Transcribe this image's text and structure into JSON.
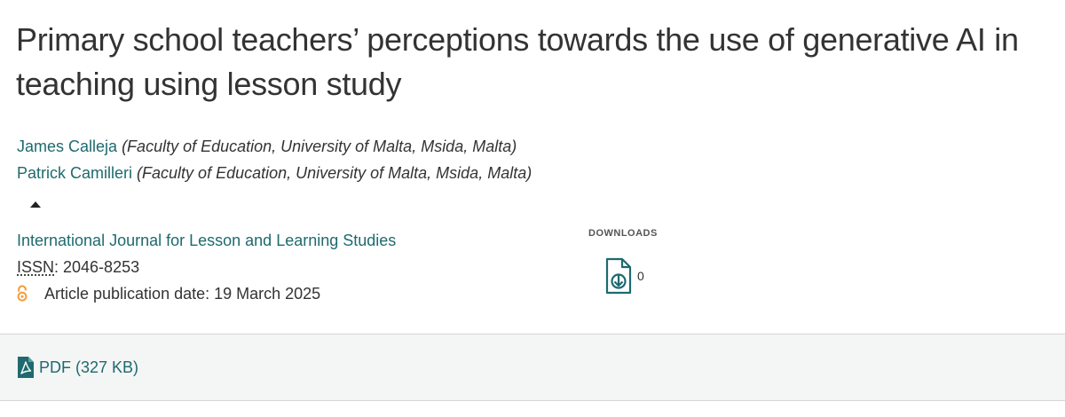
{
  "article": {
    "title_line1": "Primary school teachers’ perceptions towards the use of generative AI in",
    "title_line2": "teaching using lesson study"
  },
  "authors": [
    {
      "name": "James Calleja",
      "affiliation": "(Faculty of Education, University of Malta, Msida, Malta)"
    },
    {
      "name": "Patrick Camilleri",
      "affiliation": "(Faculty of Education, University of Malta, Msida, Malta)"
    }
  ],
  "publication": {
    "journal": "International Journal for Lesson and Learning Studies",
    "issn_label": "ISSN",
    "issn_value": ": 2046-8253",
    "date_text": "Article publication date: 19 March 2025"
  },
  "downloads": {
    "label": "DOWNLOADS",
    "count": "0"
  },
  "pdf": {
    "label": "PDF (327 KB)"
  },
  "colors": {
    "link": "#1e6a6e",
    "open_access": "#f39c3c",
    "text": "#333333"
  },
  "icons": {
    "toggle": "caret-up-icon",
    "open_access": "open-access-icon",
    "download": "file-download-icon",
    "pdf": "pdf-icon"
  }
}
